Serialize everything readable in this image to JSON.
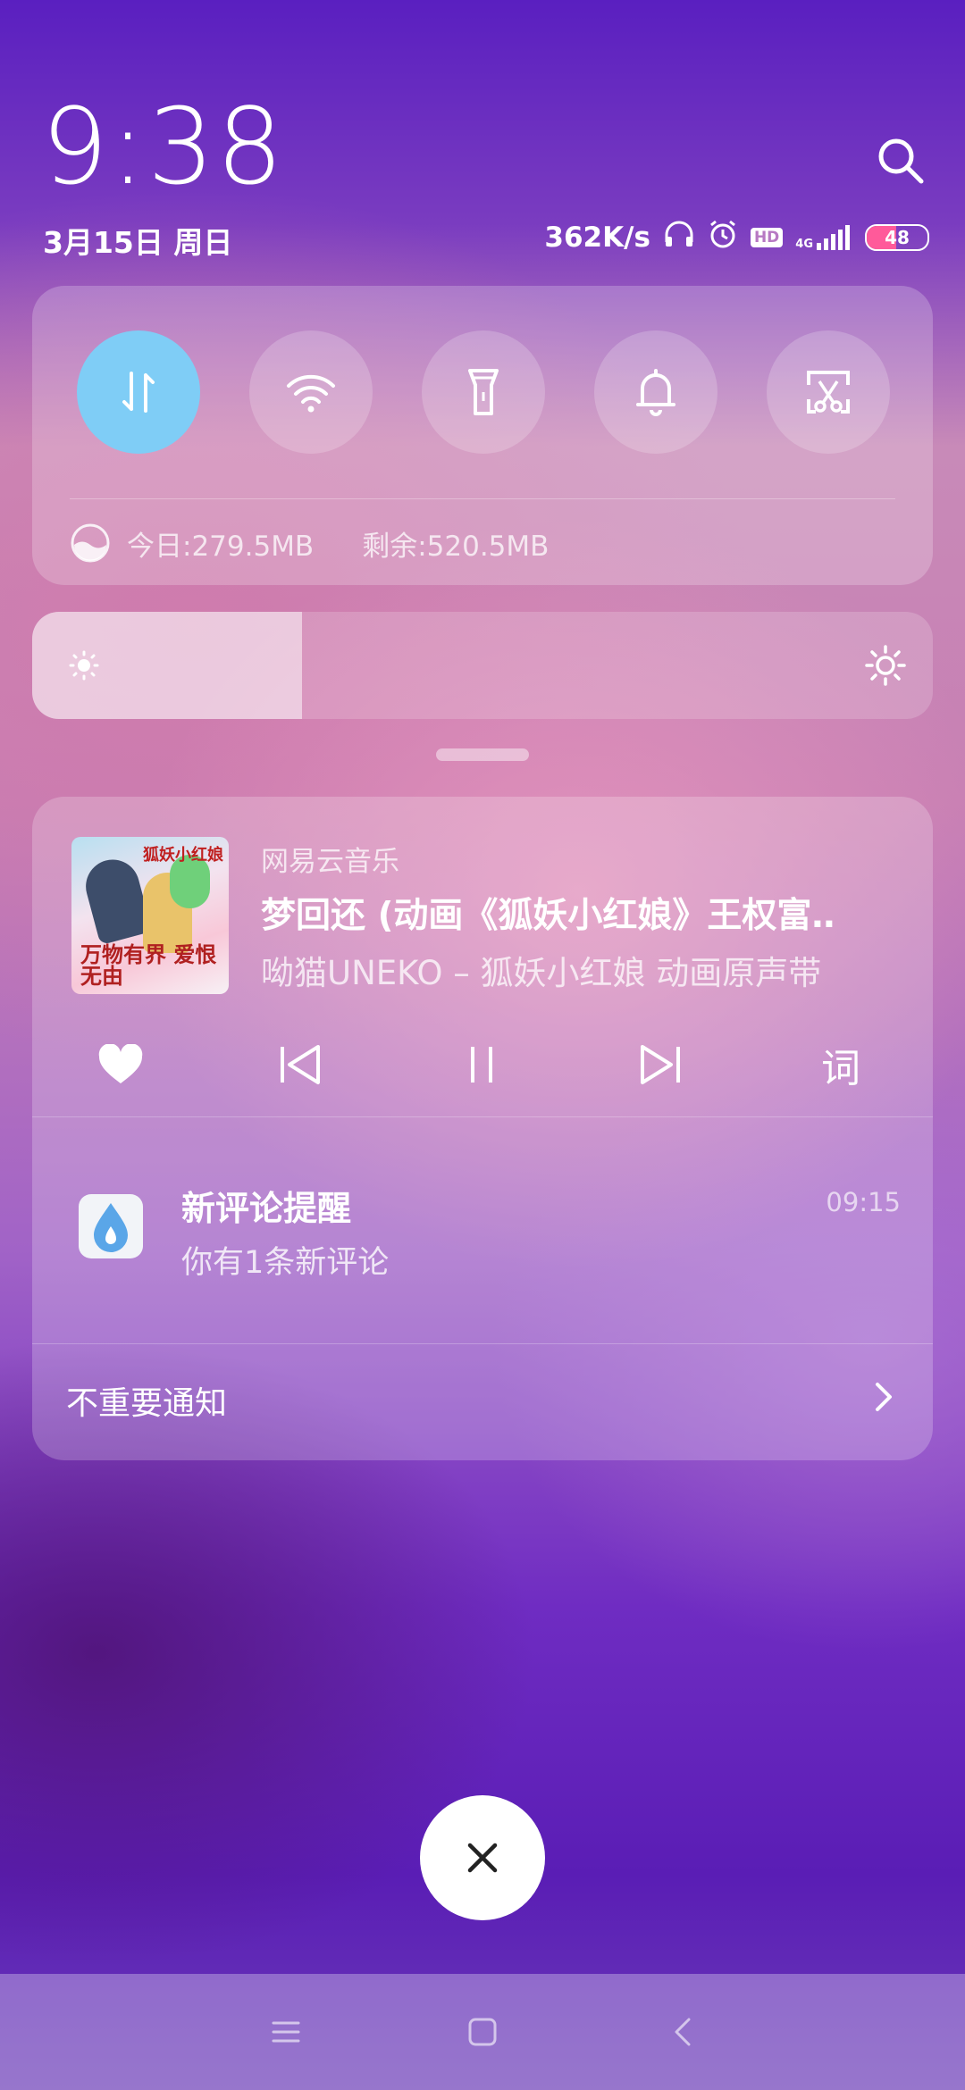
{
  "status": {
    "time": "9:38",
    "date": "3月15日 周日",
    "net_speed": "362K/s",
    "network": "4G",
    "hd_label": "HD",
    "battery": "48"
  },
  "quick_settings": {
    "toggles": [
      {
        "name": "mobile-data",
        "icon": "data-arrows-icon",
        "active": true
      },
      {
        "name": "wifi",
        "icon": "wifi-icon",
        "active": false
      },
      {
        "name": "flashlight",
        "icon": "flashlight-icon",
        "active": false
      },
      {
        "name": "sound",
        "icon": "bell-icon",
        "active": false
      },
      {
        "name": "screenshot",
        "icon": "screenshot-scissors-icon",
        "active": false
      }
    ],
    "data_today": "今日:279.5MB",
    "data_remaining": "剩余:520.5MB"
  },
  "brightness": {
    "level": 0.3
  },
  "music": {
    "app": "网易云音乐",
    "title": "梦回还 (动画《狐妖小红娘》王权富‥",
    "artist": "呦猫UNEKO – 狐妖小红娘 动画原声带",
    "album_text": "万物有界 爱恨无由",
    "album_logo": "狐妖小红娘",
    "lyrics_label": "词"
  },
  "comment_notif": {
    "title": "新评论提醒",
    "time": "09:15",
    "body": "你有1条新评论"
  },
  "unimportant": {
    "label": "不重要通知"
  },
  "colors": {
    "active_toggle": "#7fcdf6",
    "battery_fill": "#ff5a9a"
  }
}
